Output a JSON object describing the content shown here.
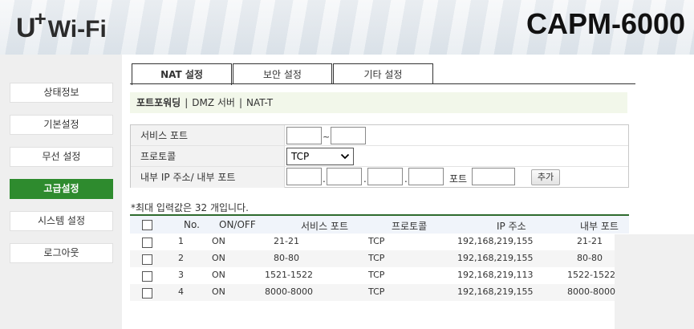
{
  "header": {
    "logo_main": "U",
    "logo_plus": "+",
    "logo_wifi": "Wi-Fi",
    "model": "CAPM-6000"
  },
  "sidebar": {
    "items": [
      {
        "label": "상태정보",
        "active": false
      },
      {
        "label": "기본설정",
        "active": false
      },
      {
        "label": "무선 설정",
        "active": false
      },
      {
        "label": "고급설정",
        "active": true
      },
      {
        "label": "시스템 설정",
        "active": false
      },
      {
        "label": "로그아웃",
        "active": false
      }
    ]
  },
  "tabs": [
    {
      "label": "NAT 설정",
      "active": true
    },
    {
      "label": "보안 설정",
      "active": false
    },
    {
      "label": "기타 설정",
      "active": false
    }
  ],
  "subnav": {
    "items": [
      "포트포워딩",
      "DMZ 서버",
      "NAT-T"
    ],
    "separator": "|"
  },
  "form": {
    "service_port_label": "서비스 포트",
    "service_port_start": "",
    "service_port_end": "",
    "tilde": "~",
    "protocol_label": "프로토콜",
    "protocol_value": "TCP",
    "internal_label": "내부 IP 주소/ 내부 포트",
    "ip1": "",
    "ip2": "",
    "ip3": "",
    "ip4": "",
    "dot": ".",
    "port_label": "포트",
    "port_value": "",
    "add_button": "추가"
  },
  "note": "*최대 입력값은 32 개입니다.",
  "table": {
    "headers": [
      "No.",
      "ON/OFF",
      "서비스 포트",
      "프로토콜",
      "IP 주소",
      "내부 포트"
    ],
    "rows": [
      {
        "no": "1",
        "onoff": "ON",
        "service_port": "21-21",
        "protocol": "TCP",
        "ip": "192,168,219,155",
        "internal_port": "21-21"
      },
      {
        "no": "2",
        "onoff": "ON",
        "service_port": "80-80",
        "protocol": "TCP",
        "ip": "192,168,219,155",
        "internal_port": "80-80"
      },
      {
        "no": "3",
        "onoff": "ON",
        "service_port": "1521-1522",
        "protocol": "TCP",
        "ip": "192,168,219,113",
        "internal_port": "1522-1522"
      },
      {
        "no": "4",
        "onoff": "ON",
        "service_port": "8000-8000",
        "protocol": "TCP",
        "ip": "192,168,219,155",
        "internal_port": "8000-8000"
      }
    ]
  },
  "colors": {
    "active_menu": "#2e8b2e",
    "table_rule": "#2e6b2e",
    "subnav_bg": "#f2f7ea"
  }
}
